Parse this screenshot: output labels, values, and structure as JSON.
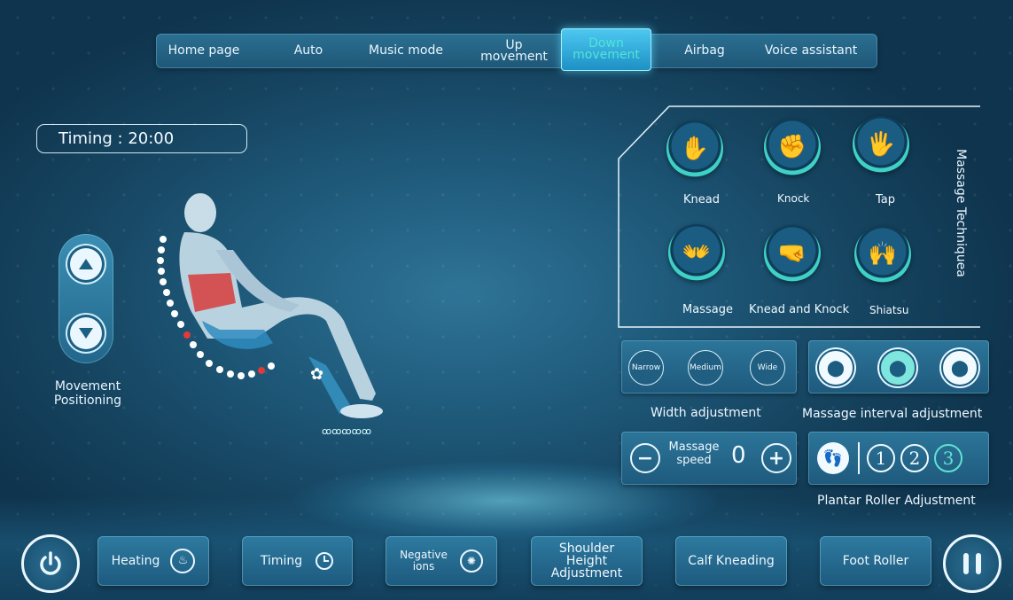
{
  "nav": {
    "tabs": [
      {
        "label": "Home page",
        "active": false
      },
      {
        "label": "Auto",
        "active": false
      },
      {
        "label": "Music mode",
        "active": false
      },
      {
        "label": "Up\nmovement",
        "active": false
      },
      {
        "label": "Down\nmovement",
        "active": true
      },
      {
        "label": "Airbag",
        "active": false
      },
      {
        "label": "Voice assistant",
        "active": false
      }
    ]
  },
  "timing": {
    "label": "Timing : 20:00"
  },
  "movement": {
    "label": "Movement\nPositioning",
    "up_icon": "arrow-up-icon",
    "down_icon": "arrow-down-icon"
  },
  "techniques": {
    "title": "Massage Techniquea",
    "items": [
      {
        "label": "Knead",
        "icon": "knead-hands-icon"
      },
      {
        "label": "Knock",
        "icon": "knock-fists-icon"
      },
      {
        "label": "Tap",
        "icon": "tap-hands-icon"
      },
      {
        "label": "Massage",
        "icon": "massage-hands-icon"
      },
      {
        "label": "Knead and Knock",
        "icon": "knead-knock-icon"
      },
      {
        "label": "Shiatsu",
        "icon": "shiatsu-hands-icon"
      }
    ]
  },
  "width": {
    "label": "Width adjustment",
    "options": [
      "Narrow",
      "Medium",
      "Wide"
    ]
  },
  "interval": {
    "label": "Massage interval adjustment"
  },
  "speed": {
    "label": "Massage\nspeed",
    "value": "0"
  },
  "plantar": {
    "label": "Plantar Roller Adjustment",
    "levels": [
      "1",
      "2",
      "3"
    ],
    "selected": "3"
  },
  "bottom": {
    "heating": "Heating",
    "timing": "Timing",
    "negative_ions": "Negative\nions",
    "shoulder": "Shoulder\nHeight\nAdjustment",
    "calf": "Calf Kneading",
    "foot": "Foot Roller"
  },
  "colors": {
    "accent": "#4fe6d8",
    "background": "#1f5a7b",
    "highlight": "#e03a3a"
  }
}
